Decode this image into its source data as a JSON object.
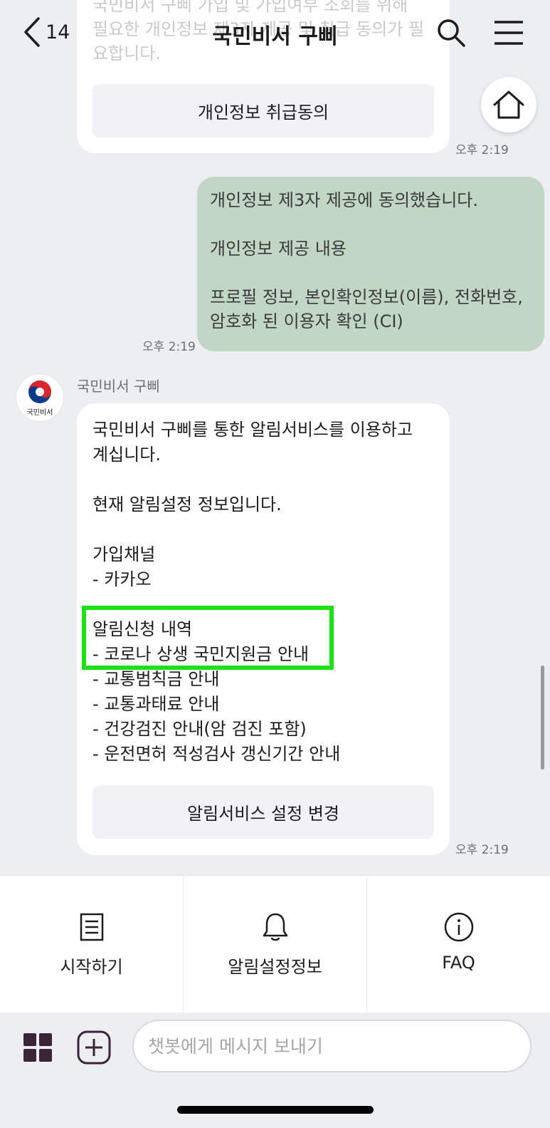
{
  "header": {
    "back_count": "14",
    "title": "국민비서 구삐"
  },
  "messages": {
    "first_bot": {
      "faded_text": "국민비서 구삐 가입 및 가입여부 조회를 위해 필요한 개인정보 제3자 제공 및 취급 동의가 필요합니다.",
      "button_label": "개인정보 취급동의",
      "time": "오후 2:19"
    },
    "user": {
      "lines": [
        "개인정보 제3자 제공에 동의했습니다.",
        "",
        "개인정보 제공 내용",
        "",
        "프로필 정보, 본인확인정보(이름), 전화번호,",
        "암호화 된 이용자 확인 (CI)"
      ],
      "time": "오후 2:19"
    },
    "second_bot": {
      "avatar_label": "국민비서",
      "sender": "국민비서 구삐",
      "lines": [
        "국민비서 구삐를 통한 알림서비스를 이용하고",
        "계십니다.",
        "",
        "현재 알림설정 정보입니다.",
        "",
        "가입채널",
        "- 카카오",
        "",
        "알림신청 내역",
        "- 코로나 상생 국민지원금 안내",
        "- 교통범칙금 안내",
        "- 교통과태료 안내",
        "- 건강검진 안내(암 검진 포함)",
        "- 운전면허 적성검사 갱신기간 안내"
      ],
      "button_label": "알림서비스 설정 변경",
      "time": "오후 2:19"
    }
  },
  "quick_menu": [
    {
      "label": "시작하기",
      "icon": "document-icon"
    },
    {
      "label": "알림설정정보",
      "icon": "bell-icon"
    },
    {
      "label": "FAQ",
      "icon": "info-icon"
    }
  ],
  "input": {
    "placeholder": "챗봇에게 메시지 보내기",
    "value": ""
  },
  "colors": {
    "user_bubble": "#c1d6c4",
    "highlight": "#1be217",
    "background": "#eceef1"
  }
}
